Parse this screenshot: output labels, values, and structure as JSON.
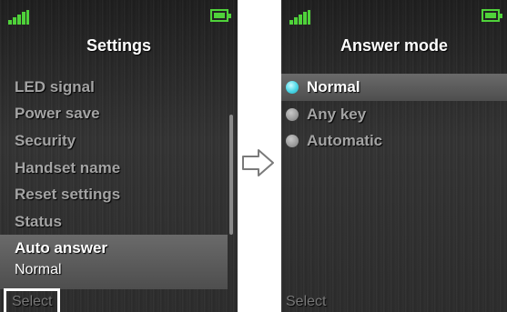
{
  "left_screen": {
    "title": "Settings",
    "menu_items": [
      {
        "label": "LED signal"
      },
      {
        "label": "Power save"
      },
      {
        "label": "Security"
      },
      {
        "label": "Handset name"
      },
      {
        "label": "Reset settings"
      },
      {
        "label": "Status"
      }
    ],
    "selected_item": {
      "label": "Auto answer",
      "value": "Normal"
    },
    "softkey_label": "Select"
  },
  "right_screen": {
    "title": "Answer mode",
    "options": [
      {
        "label": "Normal",
        "selected": true
      },
      {
        "label": "Any key",
        "selected": false
      },
      {
        "label": "Automatic",
        "selected": false
      }
    ],
    "softkey_label": "Select"
  },
  "colors": {
    "status_green": "#4fd23a",
    "radio_active": "#48d6e6",
    "highlight": "#5a5a5a"
  },
  "icons": {
    "signal": "signal-strength-icon",
    "battery": "battery-icon",
    "arrow": "right-arrow-icon"
  }
}
